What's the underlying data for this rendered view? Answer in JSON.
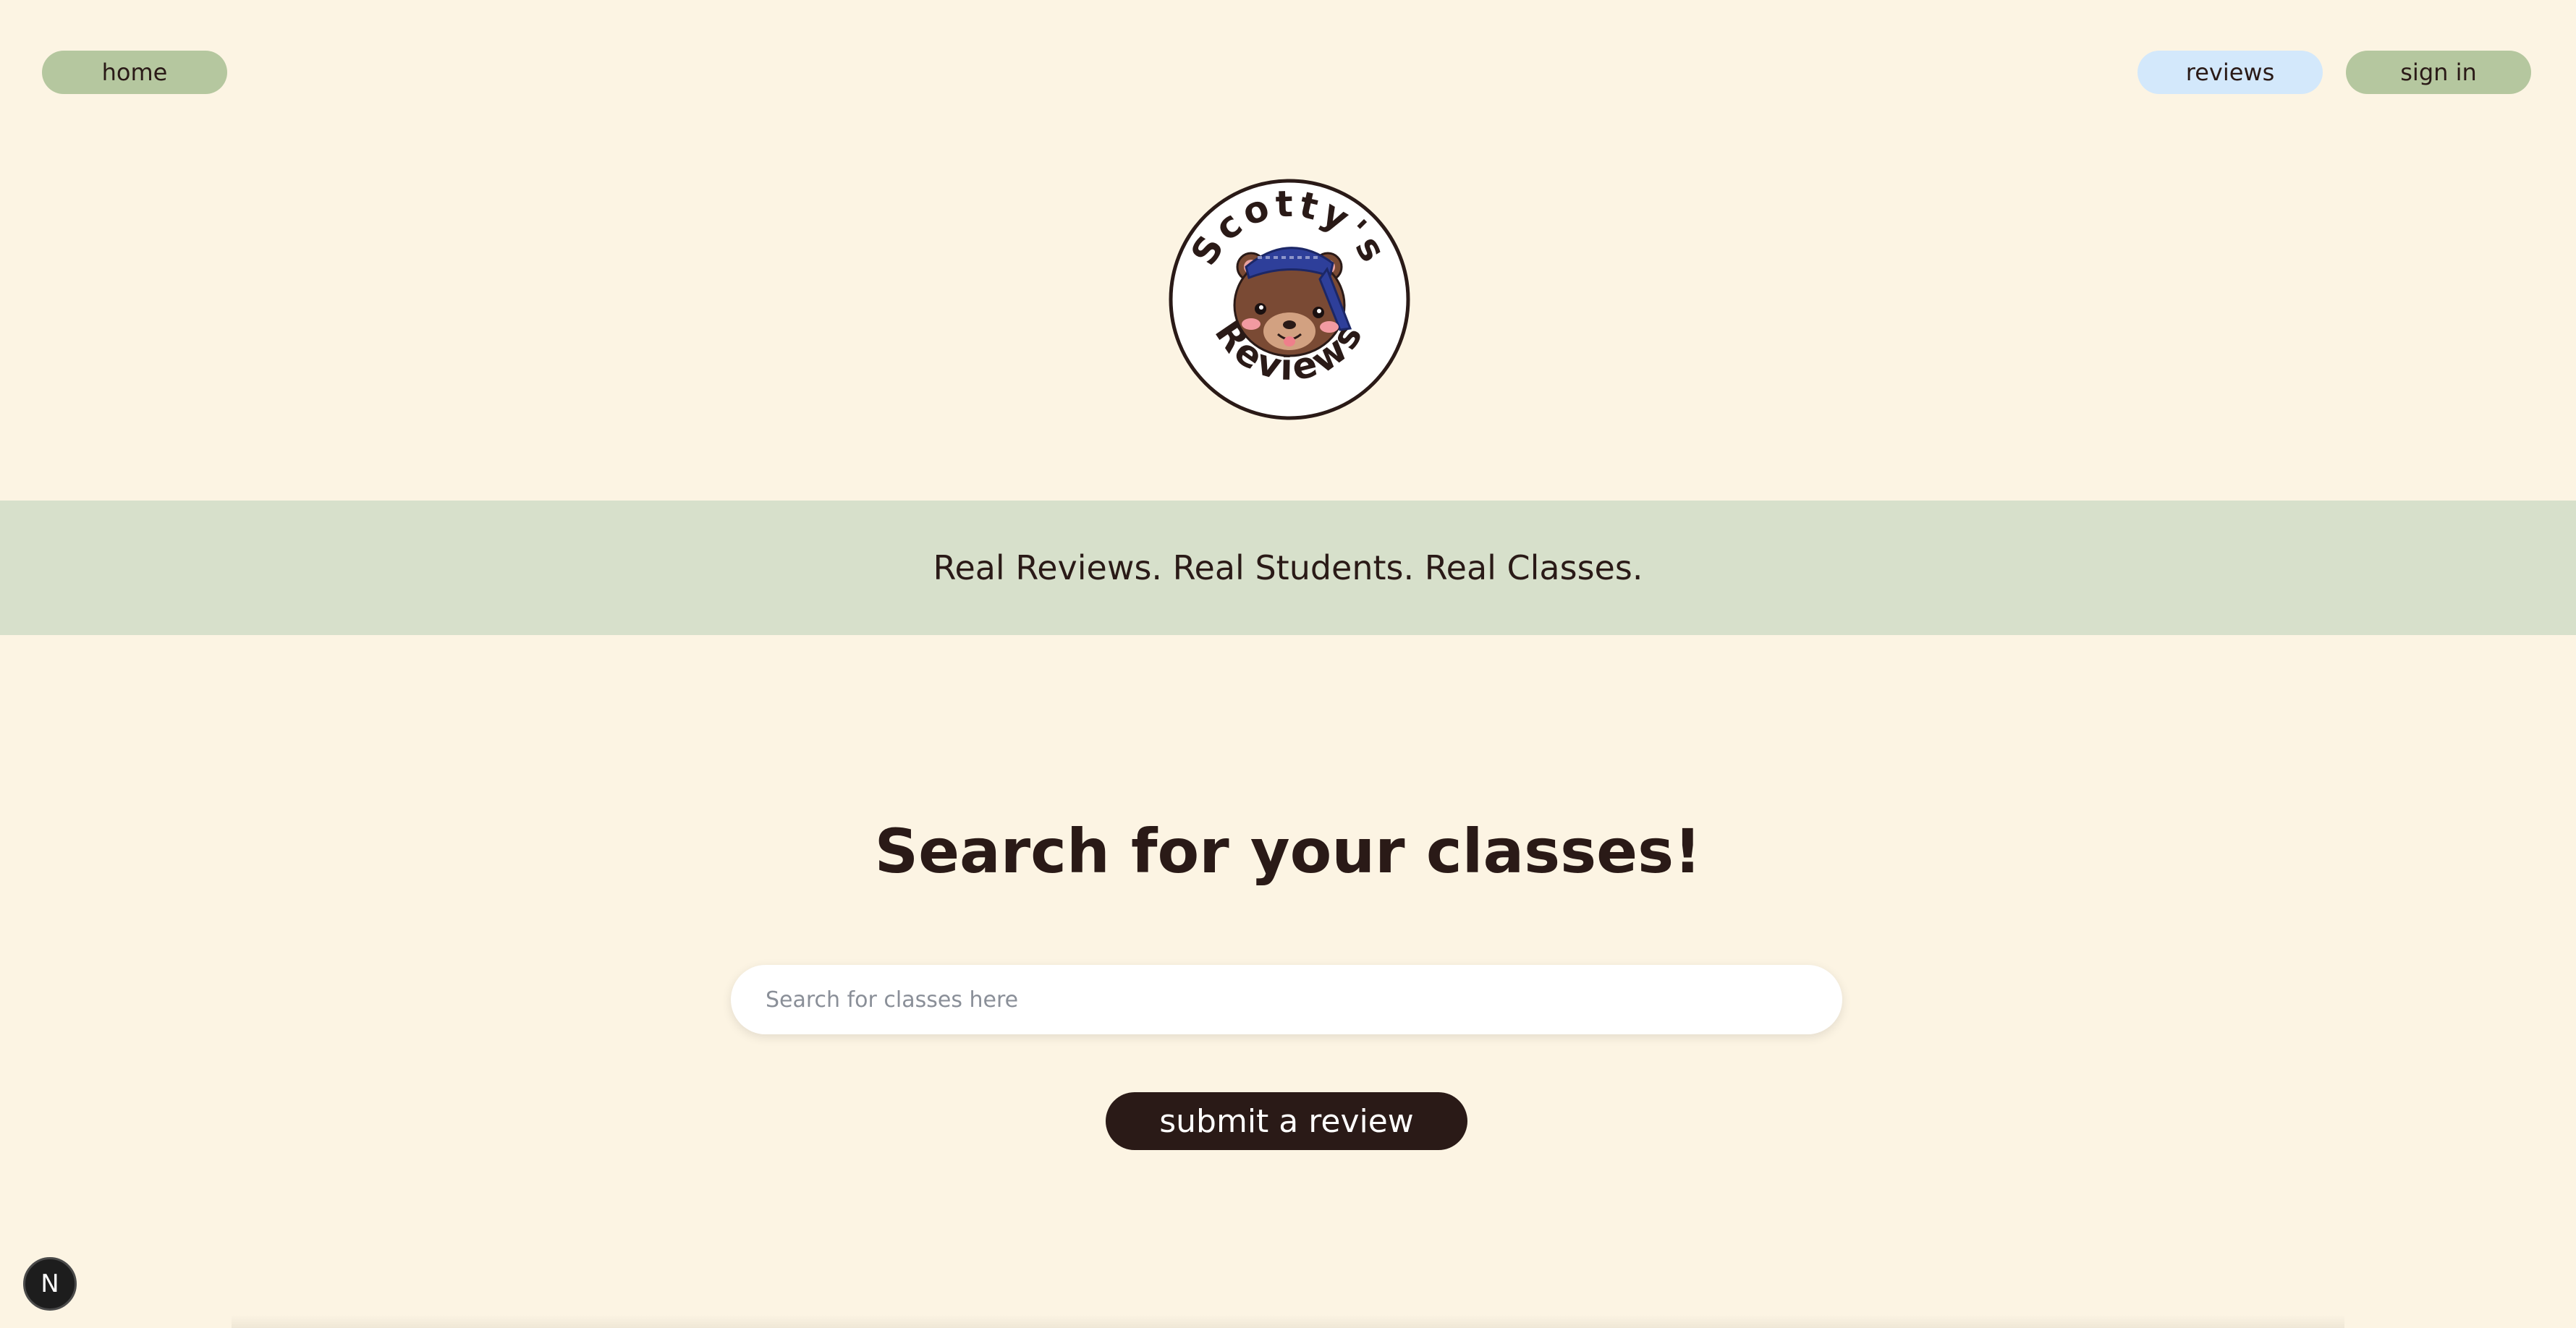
{
  "nav": {
    "home_label": "home",
    "reviews_label": "reviews",
    "signin_label": "sign in"
  },
  "logo": {
    "top_text": "Scotty's",
    "bottom_text": "Reviews",
    "icon": "bear-mascot-icon"
  },
  "tagline": "Real Reviews. Real Students. Real Classes.",
  "main": {
    "heading": "Search for your classes!",
    "search_placeholder": "Search for classes here",
    "search_value": "",
    "submit_label": "submit a review"
  },
  "badge": {
    "letter": "N",
    "icon": "n-badge-icon"
  },
  "colors": {
    "background": "#fcf4e3",
    "nav_green": "#b5c79f",
    "nav_blue": "#d3e8fb",
    "band_green": "#d7e0cb",
    "dark": "#2a1a17"
  }
}
